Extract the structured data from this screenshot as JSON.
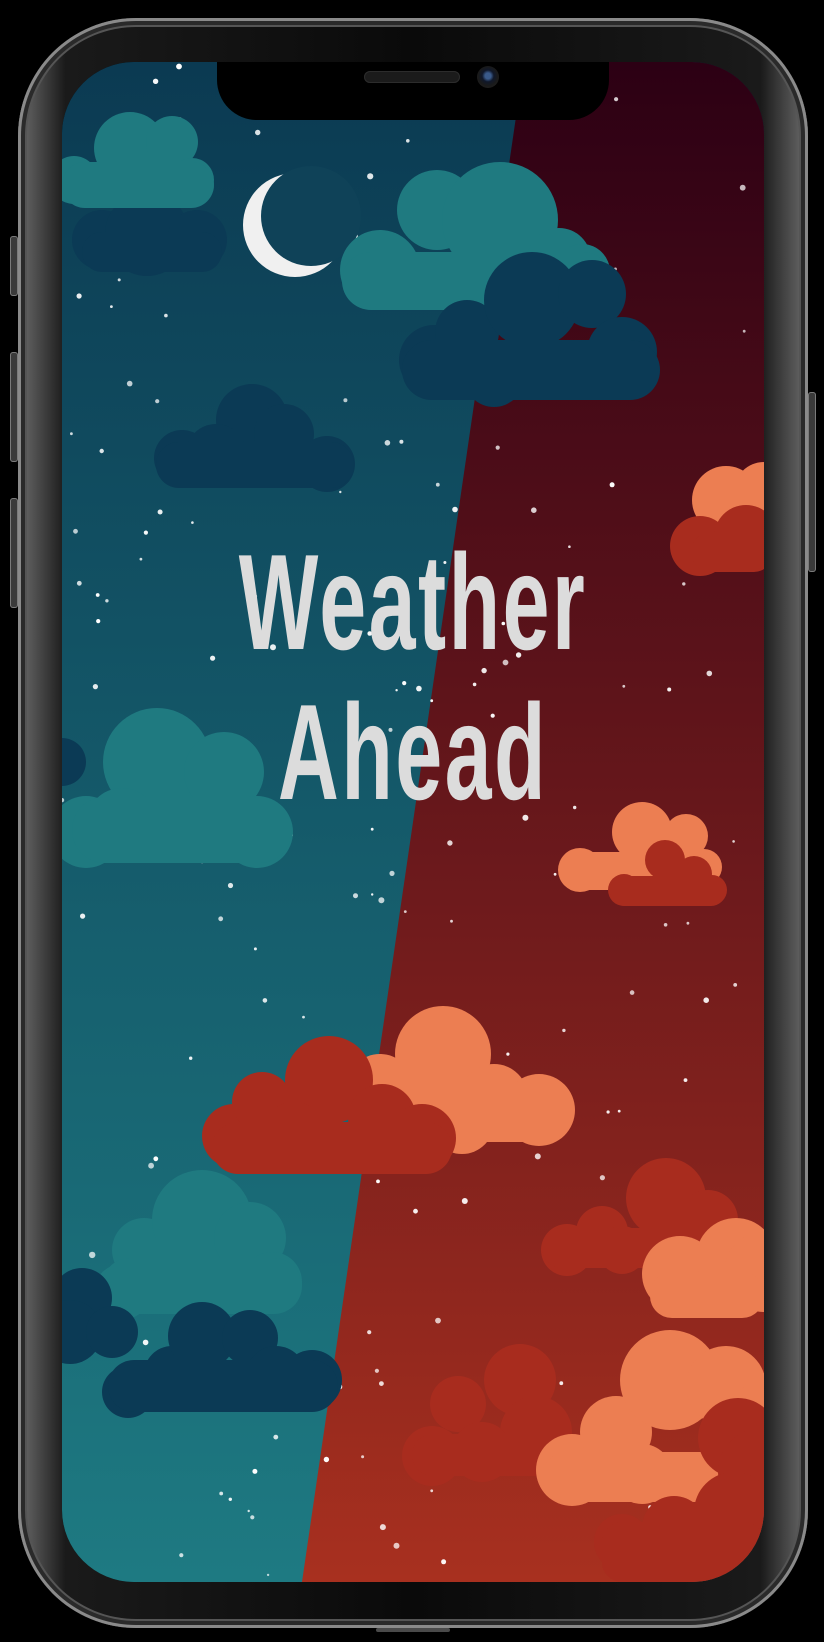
{
  "splash": {
    "title_line1": "Weather",
    "title_line2": "Ahead"
  },
  "icons": {
    "moon": "crescent-moon-icon",
    "clouds": "cloud-icon",
    "stars": "star-icon"
  },
  "colors": {
    "night_top": "#0b3a52",
    "night_bottom": "#1e7a82",
    "sunset_top": "#2c0014",
    "sunset_bottom": "#a8301f",
    "cloud_teal": "#1f7a80",
    "cloud_navy": "#0b3a55",
    "cloud_orange": "#ec7e52",
    "cloud_red": "#a82c1e",
    "title_text": "#dcdcdc"
  }
}
